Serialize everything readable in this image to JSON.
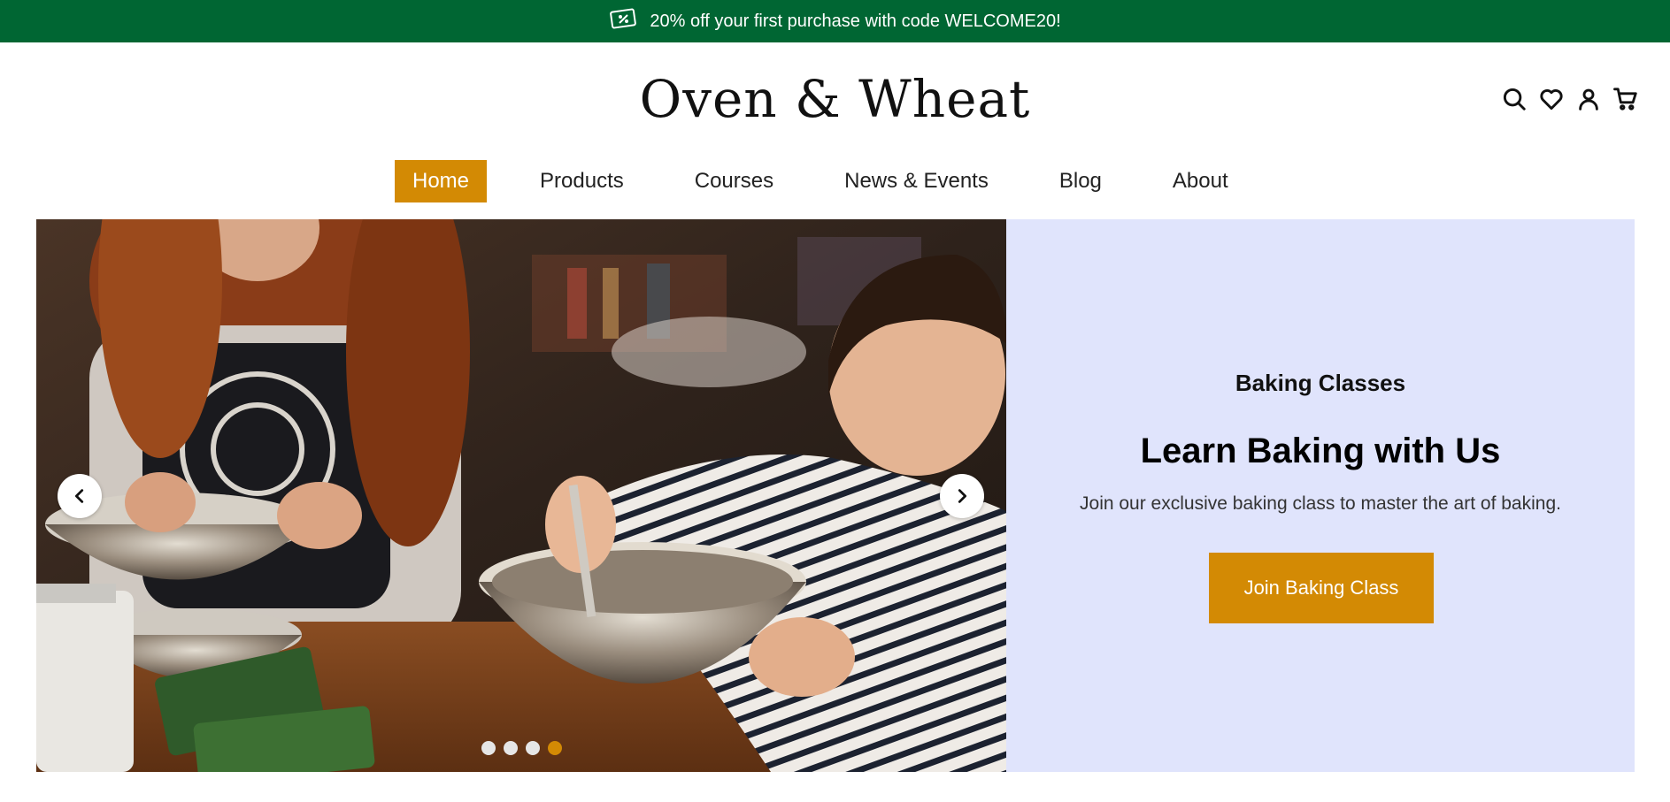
{
  "promo": {
    "icon": "coupon-icon",
    "text": "20% off your first purchase with code WELCOME20!"
  },
  "header": {
    "logo": "Oven & Wheat",
    "icons": [
      "search-icon",
      "heart-icon",
      "user-icon",
      "cart-icon"
    ]
  },
  "nav": {
    "items": [
      {
        "label": "Home",
        "active": true
      },
      {
        "label": "Products"
      },
      {
        "label": "Courses"
      },
      {
        "label": "News & Events"
      },
      {
        "label": "Blog"
      },
      {
        "label": "About"
      }
    ]
  },
  "hero": {
    "slide_count": 4,
    "active_slide": 4,
    "eyebrow": "Baking Classes",
    "headline": "Learn Baking with Us",
    "subtext": "Join our exclusive baking class to master the art of baking.",
    "cta_label": "Join Baking Class"
  },
  "colors": {
    "promo_bg": "#006633",
    "accent": "#d38a04",
    "panel_bg": "#e0e4fc"
  }
}
